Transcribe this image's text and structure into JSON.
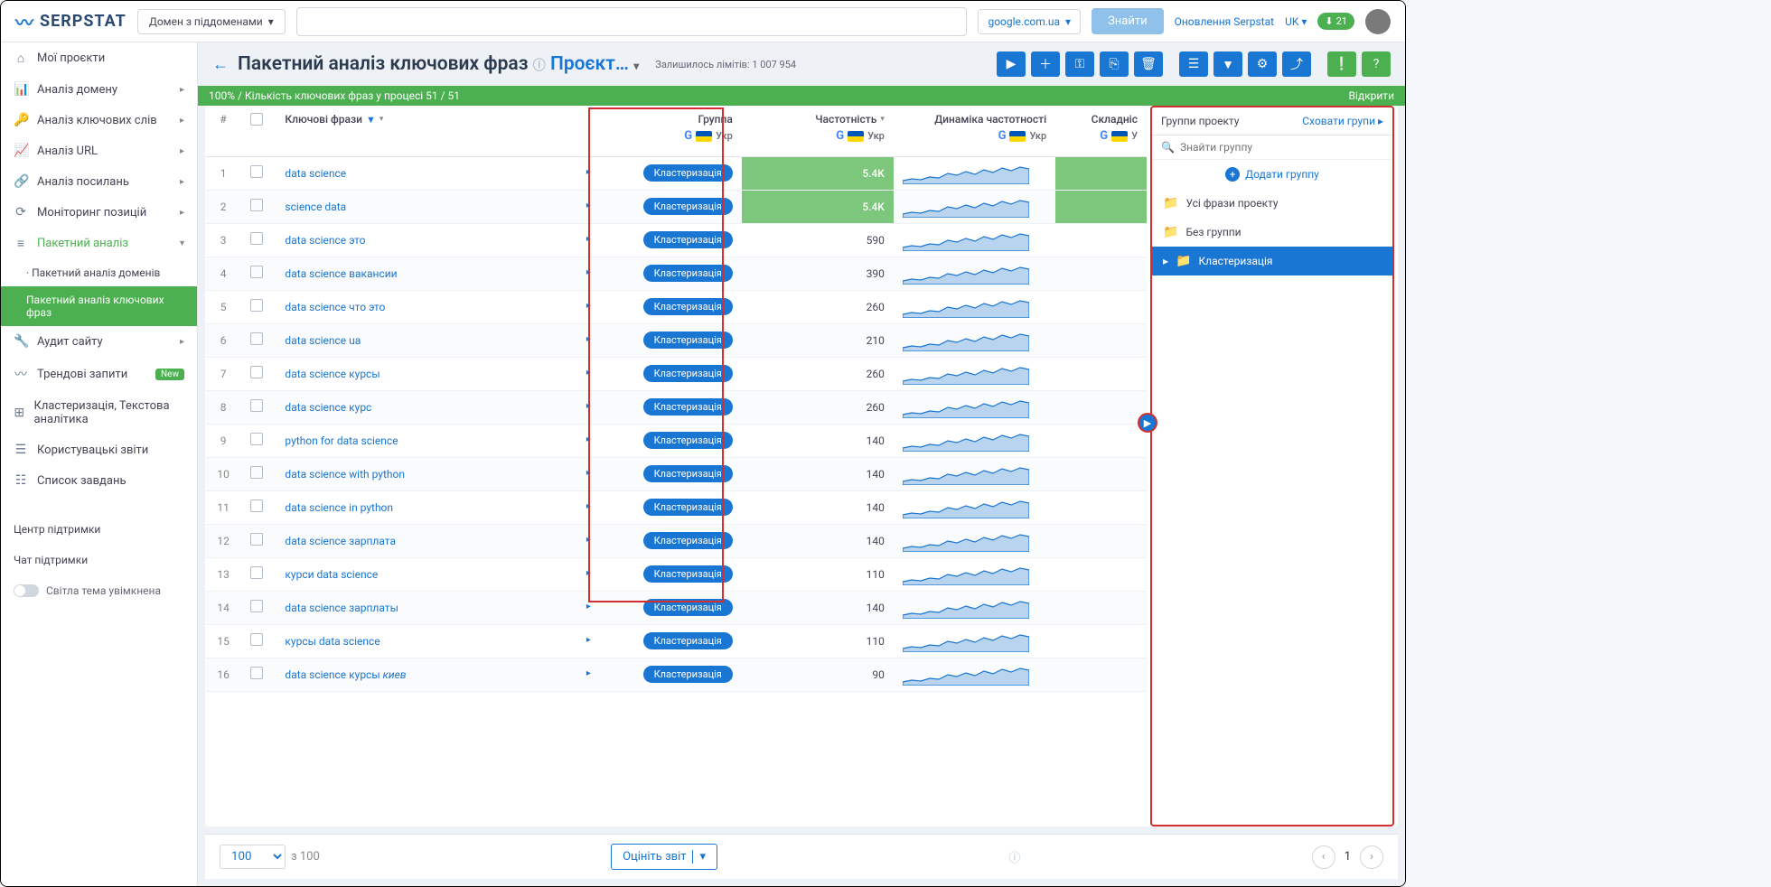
{
  "header": {
    "logo": "SERPSTAT",
    "search_type": "Домен з піддоменами",
    "se_select": "google.com.ua",
    "search_btn": "Знайти",
    "update_link": "Оновлення Serpstat",
    "lang": "UK",
    "download_count": "21"
  },
  "sidebar": {
    "items": [
      {
        "icon": "⌂",
        "label": "Мої проєкти",
        "chev": false
      },
      {
        "icon": "📊",
        "label": "Аналіз домену",
        "chev": true
      },
      {
        "icon": "🔑",
        "label": "Аналіз ключових слів",
        "chev": true
      },
      {
        "icon": "📈",
        "label": "Аналіз URL",
        "chev": true
      },
      {
        "icon": "🔗",
        "label": "Аналіз посилань",
        "chev": true
      },
      {
        "icon": "⟳",
        "label": "Моніторинг позицій",
        "chev": true
      },
      {
        "icon": "≡",
        "label": "Пакетний аналіз",
        "chev": true,
        "active": true
      }
    ],
    "subs": [
      {
        "label": "Пакетний аналіз доменів",
        "current": false
      },
      {
        "label": "Пакетний аналіз ключових фраз",
        "current": true
      }
    ],
    "items2": [
      {
        "icon": "🔧",
        "label": "Аудит сайту",
        "chev": true
      },
      {
        "icon": "〰",
        "label": "Трендові запити",
        "badge": "New"
      },
      {
        "icon": "⊞",
        "label": "Кластеризація, Текстова аналітика"
      },
      {
        "icon": "☰",
        "label": "Користувацькі звіти"
      },
      {
        "icon": "☷",
        "label": "Список завдань"
      }
    ],
    "footer1": "Центр підтримки",
    "footer2": "Чат підтримки",
    "theme": "Світла тема увімкнена"
  },
  "page": {
    "title": "Пакетний аналіз ключових фраз",
    "project": "Проєкт…",
    "limits_label": "Залишилось лімітів:",
    "limits_value": "1 007 954",
    "progress": "100% / Кількість ключових фраз у процесі 51 / 51",
    "open": "Відкрити"
  },
  "columns": {
    "num": "#",
    "keywords": "Ключові фрази",
    "group": "Группа",
    "frequency": "Частотність",
    "dynamics": "Динаміка частотності",
    "difficulty": "Складніс",
    "region": "Укр"
  },
  "rows": [
    {
      "n": 1,
      "kw": "data science",
      "group": "Кластеризація",
      "freq": "5.4K",
      "hl": true
    },
    {
      "n": 2,
      "kw": "science data",
      "group": "Кластеризація",
      "freq": "5.4K",
      "hl": true
    },
    {
      "n": 3,
      "kw": "data science это",
      "group": "Кластеризація",
      "freq": "590"
    },
    {
      "n": 4,
      "kw": "data science вакансии",
      "group": "Кластеризація",
      "freq": "390"
    },
    {
      "n": 5,
      "kw": "data science что это",
      "group": "Кластеризація",
      "freq": "260"
    },
    {
      "n": 6,
      "kw": "data science ua",
      "group": "Кластеризація",
      "freq": "210"
    },
    {
      "n": 7,
      "kw": "data science курсы",
      "group": "Кластеризація",
      "freq": "260"
    },
    {
      "n": 8,
      "kw": "data science курс",
      "group": "Кластеризація",
      "freq": "260"
    },
    {
      "n": 9,
      "kw": "python for data science",
      "group": "Кластеризація",
      "freq": "140"
    },
    {
      "n": 10,
      "kw": "data science with python",
      "group": "Кластеризація",
      "freq": "140"
    },
    {
      "n": 11,
      "kw": "data science in python",
      "group": "Кластеризація",
      "freq": "140"
    },
    {
      "n": 12,
      "kw": "data science зарплата",
      "group": "Кластеризація",
      "freq": "140"
    },
    {
      "n": 13,
      "kw": "курси data science",
      "group": "Кластеризація",
      "freq": "110"
    },
    {
      "n": 14,
      "kw": "data science зарплаты",
      "group": "Кластеризація",
      "freq": "140"
    },
    {
      "n": 15,
      "kw": "курсы data science",
      "group": "Кластеризація",
      "freq": "110"
    },
    {
      "n": 16,
      "kw": "data science курсы",
      "kw_ital": "киев",
      "group": "Кластеризація",
      "freq": "90"
    }
  ],
  "right_panel": {
    "title": "Группи проекту",
    "hide": "Сховати групи",
    "search_ph": "Знайти группу",
    "add": "Додати группу",
    "items": [
      {
        "label": "Усі фрази проекту",
        "active": false
      },
      {
        "label": "Без группи",
        "active": false
      },
      {
        "label": "Кластеризація",
        "active": true,
        "expand": true
      }
    ]
  },
  "footer": {
    "page_size": "100",
    "of_label": "з 100",
    "rate": "Оцініть звіт",
    "page": "1"
  }
}
